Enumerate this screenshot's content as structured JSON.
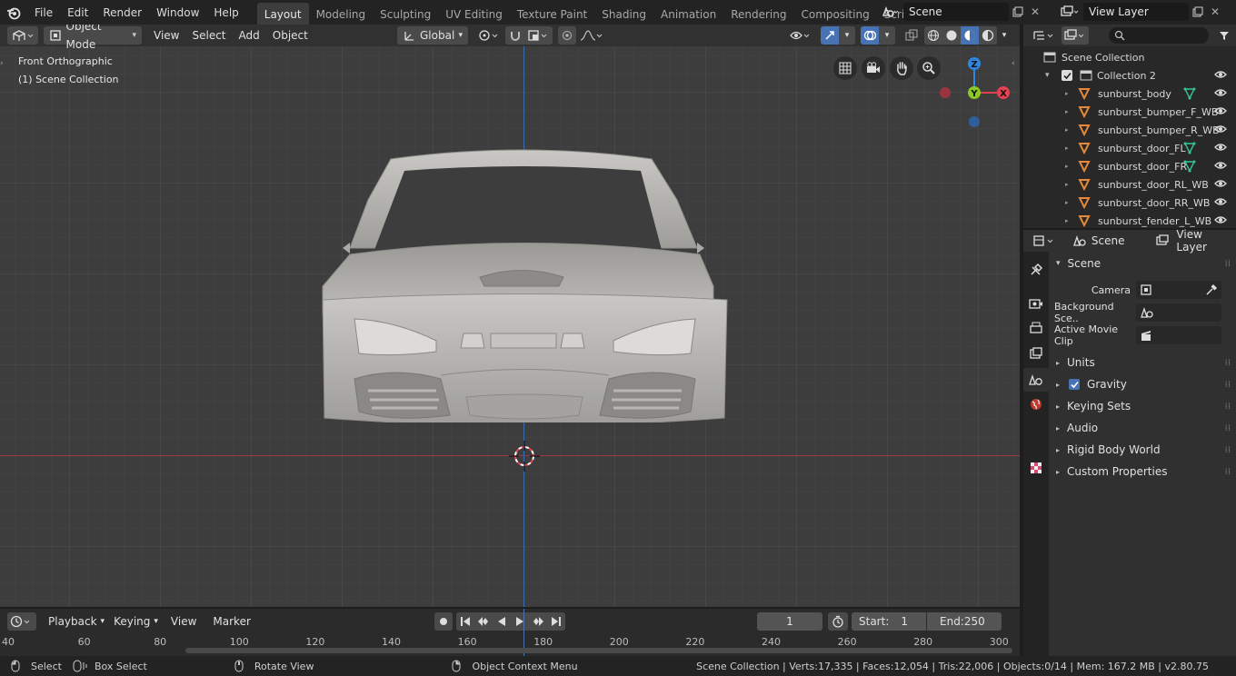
{
  "menu": [
    "File",
    "Edit",
    "Render",
    "Window",
    "Help"
  ],
  "workspaces": [
    {
      "label": "Layout",
      "active": true
    },
    {
      "label": "Modeling"
    },
    {
      "label": "Sculpting"
    },
    {
      "label": "UV Editing"
    },
    {
      "label": "Texture Paint"
    },
    {
      "label": "Shading"
    },
    {
      "label": "Animation"
    },
    {
      "label": "Rendering"
    },
    {
      "label": "Compositing"
    },
    {
      "label": "Scripting"
    }
  ],
  "scene_field": "Scene",
  "view_layer_field": "View Layer",
  "viewport": {
    "mode": "Object Mode",
    "menus": [
      "View",
      "Select",
      "Add",
      "Object"
    ],
    "transform_orientation": "Global",
    "view_name": "Front Orthographic",
    "collection_info": "(1) Scene Collection",
    "gizmo": {
      "z": "Z",
      "y": "Y",
      "x": "X"
    }
  },
  "outliner": {
    "root": "Scene Collection",
    "collection": "Collection 2",
    "objects": [
      {
        "name": "sunburst_body",
        "modifier": true
      },
      {
        "name": "sunburst_bumper_F_WB",
        "modifier": false
      },
      {
        "name": "sunburst_bumper_R_WB",
        "modifier": false
      },
      {
        "name": "sunburst_door_FL",
        "modifier": true
      },
      {
        "name": "sunburst_door_FR",
        "modifier": true
      },
      {
        "name": "sunburst_door_RL_WB",
        "modifier": false
      },
      {
        "name": "sunburst_door_RR_WB",
        "modifier": false
      },
      {
        "name": "sunburst_fender_L_WB",
        "modifier": false
      }
    ]
  },
  "properties": {
    "breadcrumb_scene": "Scene",
    "breadcrumb_view_layer": "View Layer",
    "panel_title": "Scene",
    "camera_label": "Camera",
    "background_scene_label": "Background Sce..",
    "active_movie_clip_label": "Active Movie Clip",
    "subpanels": [
      "Units",
      "Gravity",
      "Keying Sets",
      "Audio",
      "Rigid Body World",
      "Custom Properties"
    ],
    "gravity_enabled": true
  },
  "timeline": {
    "menus": [
      "Playback",
      "Keying",
      "View",
      "Marker"
    ],
    "current_frame": "1",
    "start_label": "Start:",
    "start_value": "1",
    "end_label": "End:",
    "end_value": "250",
    "ruler": [
      "40",
      "60",
      "80",
      "100",
      "120",
      "140",
      "160",
      "180",
      "200",
      "220",
      "240",
      "260",
      "280",
      "300"
    ]
  },
  "status": {
    "select": "Select",
    "box_select": "Box Select",
    "rotate_view": "Rotate View",
    "context_menu": "Object Context Menu",
    "stats": "Scene Collection | Verts:17,335 | Faces:12,054 | Tris:22,006 | Objects:0/14 | Mem: 167.2 MB | v2.80.75"
  },
  "colors": {
    "accent": "#4772b3",
    "x_axis": "#e54150",
    "y_axis": "#8bc924",
    "z_axis": "#2f86df",
    "object_icon": "#e5883a",
    "modifier": "#37c596"
  }
}
